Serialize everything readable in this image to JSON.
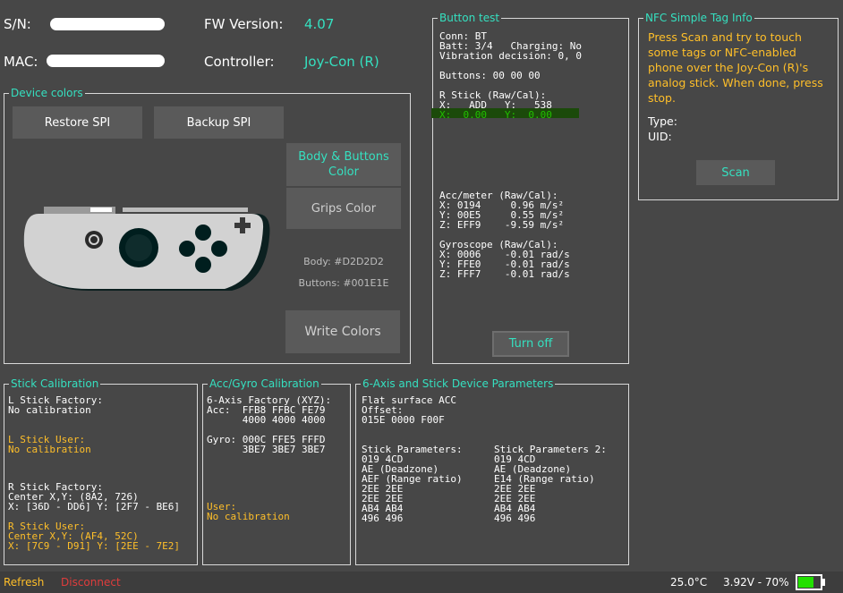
{
  "header": {
    "sn_label": "S/N:",
    "mac_label": "MAC:",
    "fw_label": "FW Version:",
    "fw_value": "4.07",
    "controller_label": "Controller:",
    "controller_value": "Joy-Con (R)"
  },
  "device_colors": {
    "title": "Device colors",
    "restore_label": "Restore SPI",
    "backup_label": "Backup SPI",
    "body_buttons_label": "Body & Buttons Color",
    "grips_label": "Grips Color",
    "body_color_text": "Body: #D2D2D2",
    "buttons_color_text": "Buttons: #001E1E",
    "write_label": "Write Colors",
    "body_color": "#D2D2D2",
    "buttons_color": "#001E1E"
  },
  "button_test": {
    "title": "Button test",
    "conn": "Conn: BT",
    "batt": "Batt: 3/4   Charging: No",
    "vibration": "Vibration decision: 0, 0",
    "buttons": "Buttons: 00 00 00",
    "rstick_header": "R Stick (Raw/Cal):",
    "rstick_raw": "X:   ADD   Y:   538",
    "rstick_cal": "X:  0.00   Y:  0.00",
    "acc_header": "Acc/meter (Raw/Cal):",
    "acc_x": "X: 0194     0.96 m/s²",
    "acc_y": "Y: 00E5     0.55 m/s²",
    "acc_z": "Z: EFF9    -9.59 m/s²",
    "gyro_header": "Gyroscope (Raw/Cal):",
    "gyro_x": "X: 0006    -0.01 rad/s",
    "gyro_y": "Y: FFE0    -0.01 rad/s",
    "gyro_z": "Z: FFF7    -0.01 rad/s",
    "turn_off_label": "Turn off"
  },
  "nfc": {
    "title": "NFC Simple Tag Info",
    "instructions": "Press Scan and try to touch some tags or NFC-enabled phone over the Joy-Con (R)'s analog stick. When done, press stop.",
    "type_label": "Type:",
    "uid_label": "UID:",
    "scan_label": "Scan"
  },
  "stick_cal": {
    "title": "Stick Calibration",
    "l_factory_header": "L Stick Factory:",
    "l_factory_value": "No calibration",
    "l_user_header": "L Stick User:",
    "l_user_value": "No calibration",
    "r_factory_header": "R Stick Factory:",
    "r_factory_center": "Center X,Y: (8A2, 726)",
    "r_factory_range": "X: [36D - DD6] Y: [2F7 - BE6]",
    "r_user_header": "R Stick User:",
    "r_user_center": "Center X,Y: (AF4, 52C)",
    "r_user_range": "X: [7C9 - D91] Y: [2EE - 7E2]"
  },
  "accgyro_cal": {
    "title": "Acc/Gyro Calibration",
    "factory_header": "6-Axis Factory (XYZ):",
    "acc_line1": "Acc:  FFB8 FFBC FE79",
    "acc_line2": "      4000 4000 4000",
    "gyro_line1": "Gyro: 000C FFE5 FFFD",
    "gyro_line2": "      3BE7 3BE7 3BE7",
    "user_header": "User:",
    "user_value": "No calibration"
  },
  "params": {
    "title": "6-Axis and Stick Device Parameters",
    "flat_line1": "Flat surface ACC",
    "flat_line2": "Offset:",
    "flat_line3": "015E 0000 F00F",
    "col1": [
      "Stick Parameters:",
      "019 4CD",
      "AE (Deadzone)",
      "AEF (Range ratio)",
      "2EE 2EE",
      "2EE 2EE",
      "AB4 AB4",
      "496 496"
    ],
    "col2": [
      "Stick Parameters 2:",
      "019 4CD",
      "AE (Deadzone)",
      "E14 (Range ratio)",
      "2EE 2EE",
      "2EE 2EE",
      "AB4 AB4",
      "496 496"
    ]
  },
  "statusbar": {
    "refresh_label": "Refresh",
    "disconnect_label": "Disconnect",
    "temperature": "25.0°C",
    "battery": "3.92V - 70%",
    "battery_level": 0.7
  }
}
